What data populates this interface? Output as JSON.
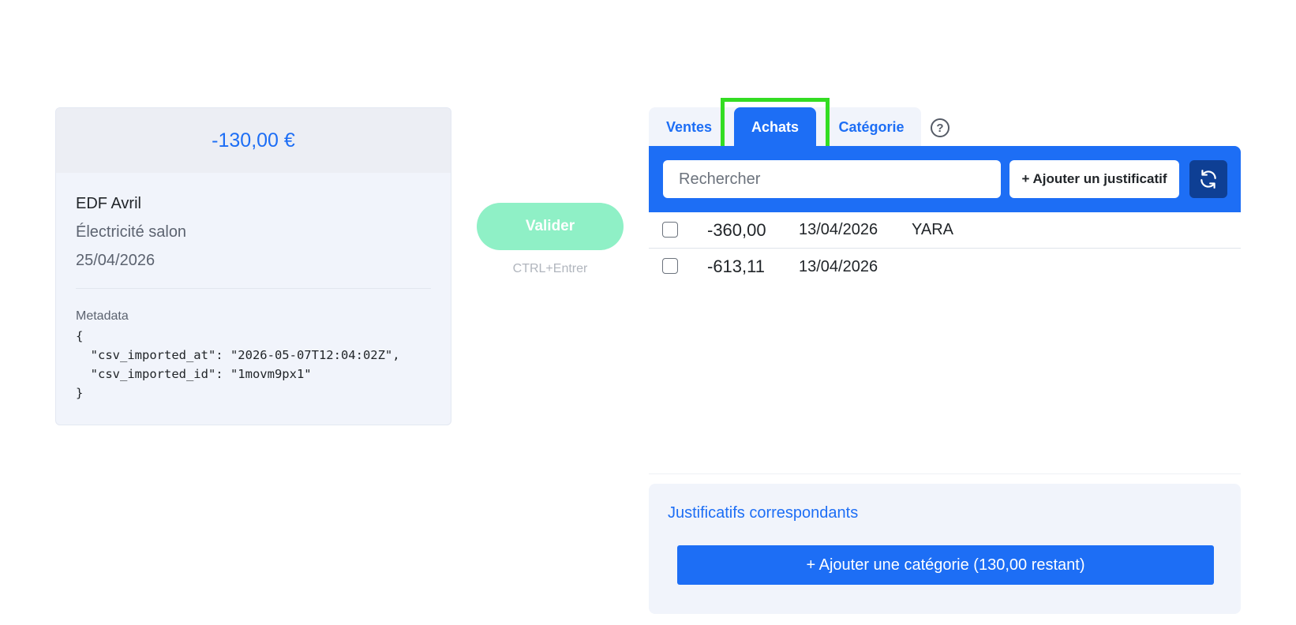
{
  "transaction": {
    "amount": "-130,00 €",
    "label": "EDF Avril",
    "description": "Électricité salon",
    "date": "25/04/2026",
    "metadata_title": "Metadata",
    "metadata_json": "{\n  \"csv_imported_at\": \"2026-05-07T12:04:02Z\",\n  \"csv_imported_id\": \"1movm9px1\"\n}"
  },
  "validate": {
    "label": "Valider",
    "hint": "CTRL+Entrer"
  },
  "tabs": [
    {
      "label": "Ventes",
      "active": false
    },
    {
      "label": "Achats",
      "active": true
    },
    {
      "label": "Catégorie",
      "active": false
    }
  ],
  "help_icon": "question-circle-icon",
  "search": {
    "placeholder": "Rechercher",
    "value": ""
  },
  "add_justificatif_label": "+ Ajouter un justificatif",
  "refresh_icon": "refresh-icon",
  "documents": [
    {
      "amount": "-360,00",
      "date": "13/04/2026",
      "name": "YARA"
    },
    {
      "amount": "-613,11",
      "date": "13/04/2026",
      "name": ""
    }
  ],
  "matching": {
    "title": "Justificatifs correspondants",
    "add_category_label": "+ Ajouter une catégorie (130,00 restant)"
  },
  "colors": {
    "primary": "#1d6ef5",
    "validate_disabled": "#8ff0c6",
    "panel_bg": "#f1f4fb",
    "refresh_bg": "#0e3f94",
    "tab_highlight": "#33dd22"
  }
}
